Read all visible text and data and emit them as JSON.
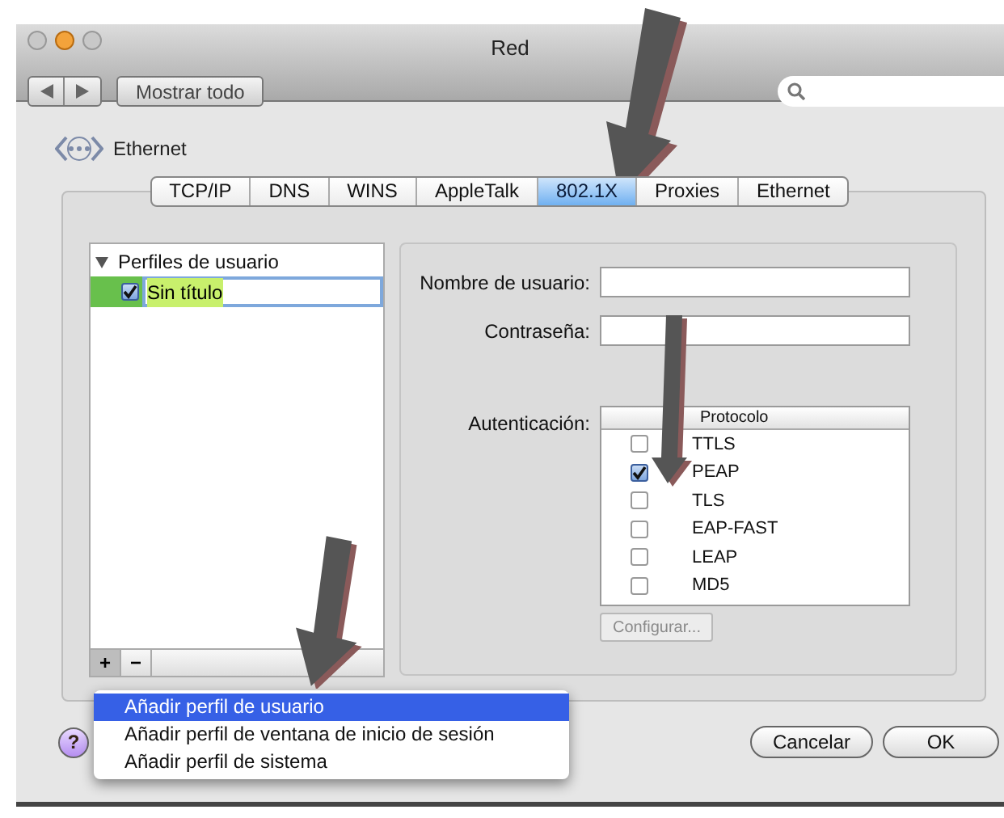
{
  "window": {
    "title": "Red"
  },
  "toolbar": {
    "show_all_button": "Mostrar todo"
  },
  "service": {
    "name": "Ethernet"
  },
  "tabs": [
    {
      "label": "TCP/IP",
      "selected": false
    },
    {
      "label": "DNS",
      "selected": false
    },
    {
      "label": "WINS",
      "selected": false
    },
    {
      "label": "AppleTalk",
      "selected": false
    },
    {
      "label": "802.1X",
      "selected": true
    },
    {
      "label": "Proxies",
      "selected": false
    },
    {
      "label": "Ethernet",
      "selected": false
    }
  ],
  "profiles": {
    "label": "Perfiles de usuario",
    "expanded": true,
    "children": [
      {
        "label": "Sin título",
        "checked": true,
        "selected": true
      }
    ]
  },
  "list_buttons": [
    "+",
    "−"
  ],
  "form": {
    "username_label": "Nombre de usuario:",
    "password_label": "Contraseña:",
    "auth_label": "Autenticación:",
    "auth_column": "Protocolo",
    "protocols": [
      {
        "label": "TTLS",
        "checked": false
      },
      {
        "label": "PEAP",
        "checked": true
      },
      {
        "label": "TLS",
        "checked": false
      },
      {
        "label": "EAP-FAST",
        "checked": false
      },
      {
        "label": "LEAP",
        "checked": false
      },
      {
        "label": "MD5",
        "checked": false
      }
    ],
    "configure_button": {
      "label": "Configurar...",
      "disabled": true
    }
  },
  "add_menu": {
    "items": [
      {
        "label": "Añadir perfil de usuario",
        "selected": true
      },
      {
        "label": "Añadir perfil de ventana de inicio de sesión",
        "selected": false
      },
      {
        "label": "Añadir perfil de sistema",
        "selected": false
      }
    ]
  },
  "help_button": "?",
  "buttons": [
    "Cancelar",
    "OK"
  ]
}
